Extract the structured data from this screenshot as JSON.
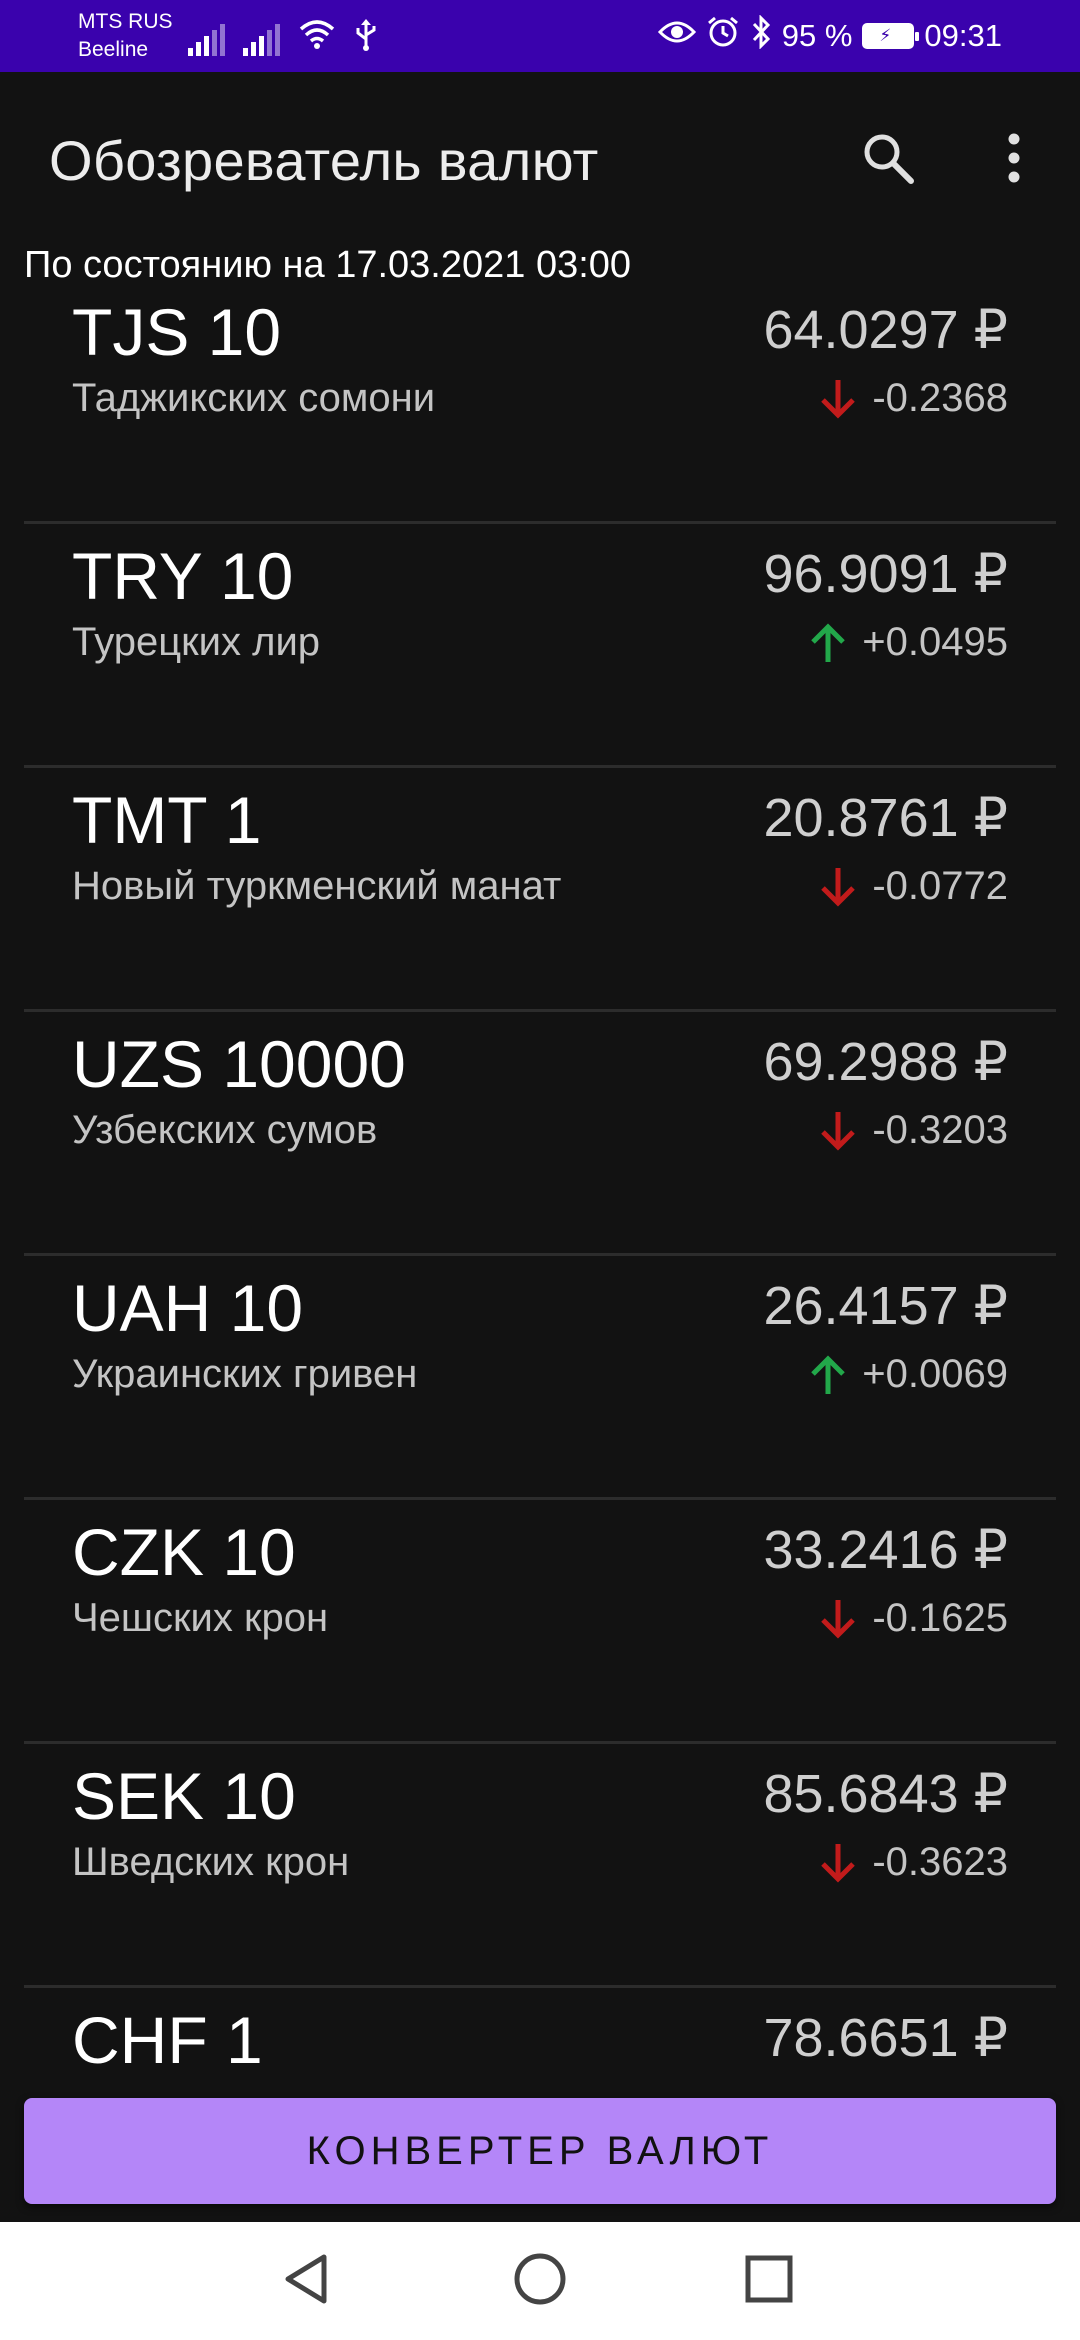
{
  "status_bar": {
    "carrier1": "MTS RUS",
    "carrier2": "Beeline",
    "battery_percent": "95 %",
    "time": "09:31"
  },
  "app_bar": {
    "title": "Обозреватель валют"
  },
  "as_of": "По состоянию на 17.03.2021 03:00",
  "currencies": [
    {
      "code": "TJS 10",
      "name": "Таджикских сомони",
      "rate": "64.0297 ₽",
      "change": "-0.2368",
      "direction": "down"
    },
    {
      "code": "TRY 10",
      "name": "Турецких лир",
      "rate": "96.9091 ₽",
      "change": "+0.0495",
      "direction": "up"
    },
    {
      "code": "TMT 1",
      "name": "Новый туркменский манат",
      "rate": "20.8761 ₽",
      "change": "-0.0772",
      "direction": "down"
    },
    {
      "code": "UZS 10000",
      "name": "Узбекских сумов",
      "rate": "69.2988 ₽",
      "change": "-0.3203",
      "direction": "down"
    },
    {
      "code": "UAH 10",
      "name": "Украинских гривен",
      "rate": "26.4157 ₽",
      "change": "+0.0069",
      "direction": "up"
    },
    {
      "code": "CZK 10",
      "name": "Чешских крон",
      "rate": "33.2416 ₽",
      "change": "-0.1625",
      "direction": "down"
    },
    {
      "code": "SEK 10",
      "name": "Шведских крон",
      "rate": "85.6843 ₽",
      "change": "-0.3623",
      "direction": "down"
    },
    {
      "code": "CHF 1",
      "name": "",
      "rate": "78.6651 ₽",
      "change": "",
      "direction": ""
    }
  ],
  "converter_button": "КОНВЕРТЕР ВАЛЮТ",
  "colors": {
    "status_bar": "#3a02ad",
    "background": "#121212",
    "accent_button": "#b486f8",
    "up": "#22a84a",
    "down": "#c21b1b"
  },
  "icons": {
    "search": "search-icon",
    "menu": "more-vert-icon",
    "up": "arrow-up-icon",
    "down": "arrow-down-icon",
    "nav_back": "back-triangle-icon",
    "nav_home": "home-circle-icon",
    "nav_recents": "recents-square-icon"
  }
}
